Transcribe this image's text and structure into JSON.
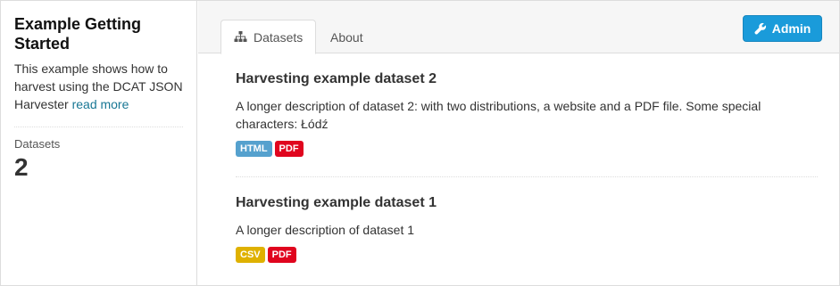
{
  "sidebar": {
    "title": "Example Getting Started",
    "description": "This example shows how to harvest using the DCAT JSON Harvester",
    "read_more": "read more",
    "stat_label": "Datasets",
    "stat_value": "2"
  },
  "tabs": {
    "datasets_label": "Datasets",
    "about_label": "About"
  },
  "admin": {
    "label": "Admin"
  },
  "datasets": [
    {
      "title": "Harvesting example dataset 2",
      "description": "A longer description of dataset 2: with two distributions, a website and a PDF file. Some special characters: Łódź",
      "formats": [
        {
          "label": "HTML",
          "color": "#55a1ce"
        },
        {
          "label": "PDF",
          "color": "#e0051e"
        }
      ]
    },
    {
      "title": "Harvesting example dataset 1",
      "description": "A longer description of dataset 1",
      "formats": [
        {
          "label": "CSV",
          "color": "#dfb100"
        },
        {
          "label": "PDF",
          "color": "#e0051e"
        }
      ]
    }
  ],
  "colors": {
    "accent": "#1a9bda",
    "link": "#187794"
  }
}
